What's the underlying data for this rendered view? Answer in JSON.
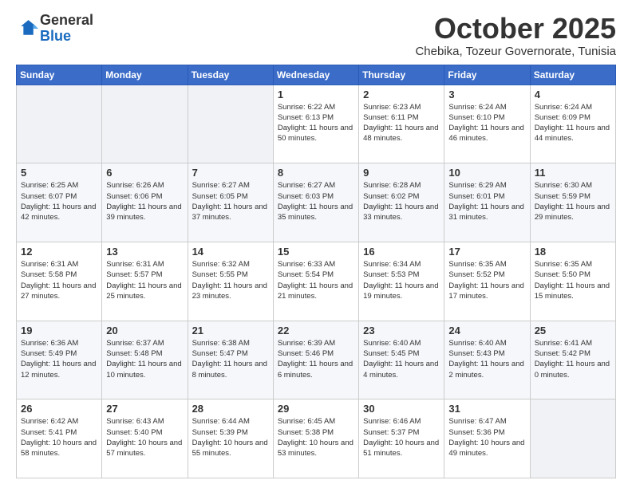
{
  "header": {
    "logo_general": "General",
    "logo_blue": "Blue",
    "month": "October 2025",
    "location": "Chebika, Tozeur Governorate, Tunisia"
  },
  "days_of_week": [
    "Sunday",
    "Monday",
    "Tuesday",
    "Wednesday",
    "Thursday",
    "Friday",
    "Saturday"
  ],
  "weeks": [
    [
      {
        "day": "",
        "info": ""
      },
      {
        "day": "",
        "info": ""
      },
      {
        "day": "",
        "info": ""
      },
      {
        "day": "1",
        "info": "Sunrise: 6:22 AM\nSunset: 6:13 PM\nDaylight: 11 hours\nand 50 minutes."
      },
      {
        "day": "2",
        "info": "Sunrise: 6:23 AM\nSunset: 6:11 PM\nDaylight: 11 hours\nand 48 minutes."
      },
      {
        "day": "3",
        "info": "Sunrise: 6:24 AM\nSunset: 6:10 PM\nDaylight: 11 hours\nand 46 minutes."
      },
      {
        "day": "4",
        "info": "Sunrise: 6:24 AM\nSunset: 6:09 PM\nDaylight: 11 hours\nand 44 minutes."
      }
    ],
    [
      {
        "day": "5",
        "info": "Sunrise: 6:25 AM\nSunset: 6:07 PM\nDaylight: 11 hours\nand 42 minutes."
      },
      {
        "day": "6",
        "info": "Sunrise: 6:26 AM\nSunset: 6:06 PM\nDaylight: 11 hours\nand 39 minutes."
      },
      {
        "day": "7",
        "info": "Sunrise: 6:27 AM\nSunset: 6:05 PM\nDaylight: 11 hours\nand 37 minutes."
      },
      {
        "day": "8",
        "info": "Sunrise: 6:27 AM\nSunset: 6:03 PM\nDaylight: 11 hours\nand 35 minutes."
      },
      {
        "day": "9",
        "info": "Sunrise: 6:28 AM\nSunset: 6:02 PM\nDaylight: 11 hours\nand 33 minutes."
      },
      {
        "day": "10",
        "info": "Sunrise: 6:29 AM\nSunset: 6:01 PM\nDaylight: 11 hours\nand 31 minutes."
      },
      {
        "day": "11",
        "info": "Sunrise: 6:30 AM\nSunset: 5:59 PM\nDaylight: 11 hours\nand 29 minutes."
      }
    ],
    [
      {
        "day": "12",
        "info": "Sunrise: 6:31 AM\nSunset: 5:58 PM\nDaylight: 11 hours\nand 27 minutes."
      },
      {
        "day": "13",
        "info": "Sunrise: 6:31 AM\nSunset: 5:57 PM\nDaylight: 11 hours\nand 25 minutes."
      },
      {
        "day": "14",
        "info": "Sunrise: 6:32 AM\nSunset: 5:55 PM\nDaylight: 11 hours\nand 23 minutes."
      },
      {
        "day": "15",
        "info": "Sunrise: 6:33 AM\nSunset: 5:54 PM\nDaylight: 11 hours\nand 21 minutes."
      },
      {
        "day": "16",
        "info": "Sunrise: 6:34 AM\nSunset: 5:53 PM\nDaylight: 11 hours\nand 19 minutes."
      },
      {
        "day": "17",
        "info": "Sunrise: 6:35 AM\nSunset: 5:52 PM\nDaylight: 11 hours\nand 17 minutes."
      },
      {
        "day": "18",
        "info": "Sunrise: 6:35 AM\nSunset: 5:50 PM\nDaylight: 11 hours\nand 15 minutes."
      }
    ],
    [
      {
        "day": "19",
        "info": "Sunrise: 6:36 AM\nSunset: 5:49 PM\nDaylight: 11 hours\nand 12 minutes."
      },
      {
        "day": "20",
        "info": "Sunrise: 6:37 AM\nSunset: 5:48 PM\nDaylight: 11 hours\nand 10 minutes."
      },
      {
        "day": "21",
        "info": "Sunrise: 6:38 AM\nSunset: 5:47 PM\nDaylight: 11 hours\nand 8 minutes."
      },
      {
        "day": "22",
        "info": "Sunrise: 6:39 AM\nSunset: 5:46 PM\nDaylight: 11 hours\nand 6 minutes."
      },
      {
        "day": "23",
        "info": "Sunrise: 6:40 AM\nSunset: 5:45 PM\nDaylight: 11 hours\nand 4 minutes."
      },
      {
        "day": "24",
        "info": "Sunrise: 6:40 AM\nSunset: 5:43 PM\nDaylight: 11 hours\nand 2 minutes."
      },
      {
        "day": "25",
        "info": "Sunrise: 6:41 AM\nSunset: 5:42 PM\nDaylight: 11 hours\nand 0 minutes."
      }
    ],
    [
      {
        "day": "26",
        "info": "Sunrise: 6:42 AM\nSunset: 5:41 PM\nDaylight: 10 hours\nand 58 minutes."
      },
      {
        "day": "27",
        "info": "Sunrise: 6:43 AM\nSunset: 5:40 PM\nDaylight: 10 hours\nand 57 minutes."
      },
      {
        "day": "28",
        "info": "Sunrise: 6:44 AM\nSunset: 5:39 PM\nDaylight: 10 hours\nand 55 minutes."
      },
      {
        "day": "29",
        "info": "Sunrise: 6:45 AM\nSunset: 5:38 PM\nDaylight: 10 hours\nand 53 minutes."
      },
      {
        "day": "30",
        "info": "Sunrise: 6:46 AM\nSunset: 5:37 PM\nDaylight: 10 hours\nand 51 minutes."
      },
      {
        "day": "31",
        "info": "Sunrise: 6:47 AM\nSunset: 5:36 PM\nDaylight: 10 hours\nand 49 minutes."
      },
      {
        "day": "",
        "info": ""
      }
    ]
  ]
}
